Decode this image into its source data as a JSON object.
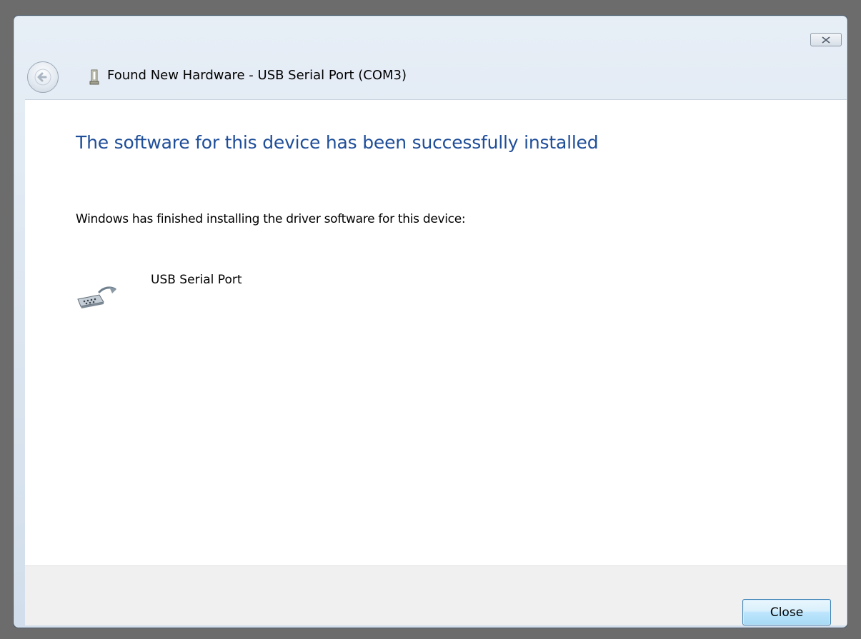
{
  "window": {
    "title": "Found New Hardware - USB Serial Port (COM3)"
  },
  "content": {
    "heading": "The software for this device has been successfully installed",
    "message": "Windows has finished installing the driver software for this device:",
    "device_name": "USB Serial Port"
  },
  "footer": {
    "close_label": "Close"
  },
  "icons": {
    "back": "back-arrow-icon",
    "hardware": "hardware-icon",
    "device": "serial-port-icon",
    "window_close": "close-icon"
  },
  "colors": {
    "heading": "#1f4e99",
    "button_border": "#3c7fb1",
    "footer_bg": "#f0f0f0"
  }
}
